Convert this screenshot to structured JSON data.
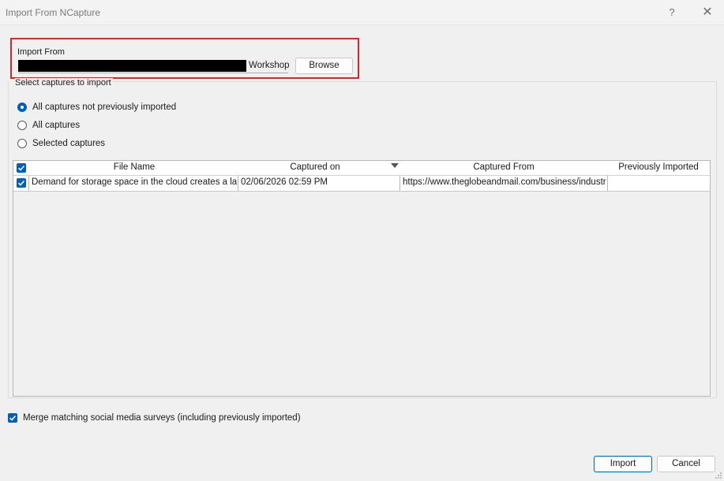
{
  "window": {
    "title": "Import From NCapture",
    "help_label": "?",
    "close_label": "✕"
  },
  "import_from": {
    "label": "Import From",
    "path_suffix": "Workshop",
    "browse_label": "Browse"
  },
  "captures": {
    "group_label": "Select captures to import",
    "options": [
      {
        "label": "All captures not previously imported",
        "checked": true
      },
      {
        "label": "All captures",
        "checked": false
      },
      {
        "label": "Selected captures",
        "checked": false
      }
    ]
  },
  "table": {
    "columns": [
      "File Name",
      "Captured on",
      "Captured From",
      "Previously Imported"
    ],
    "rows": [
      {
        "checked": true,
        "file_name": "Demand for storage space in the cloud creates a la",
        "captured_on": "02/06/2026 02:59 PM",
        "captured_from": "https://www.theglobeandmail.com/business/industr",
        "previously_imported": ""
      }
    ]
  },
  "merge": {
    "label": "Merge matching social media surveys (including previously imported)",
    "checked": true
  },
  "footer": {
    "import_label": "Import",
    "cancel_label": "Cancel"
  },
  "colors": {
    "accent": "#005fb8",
    "highlight_border": "#d9272e"
  }
}
